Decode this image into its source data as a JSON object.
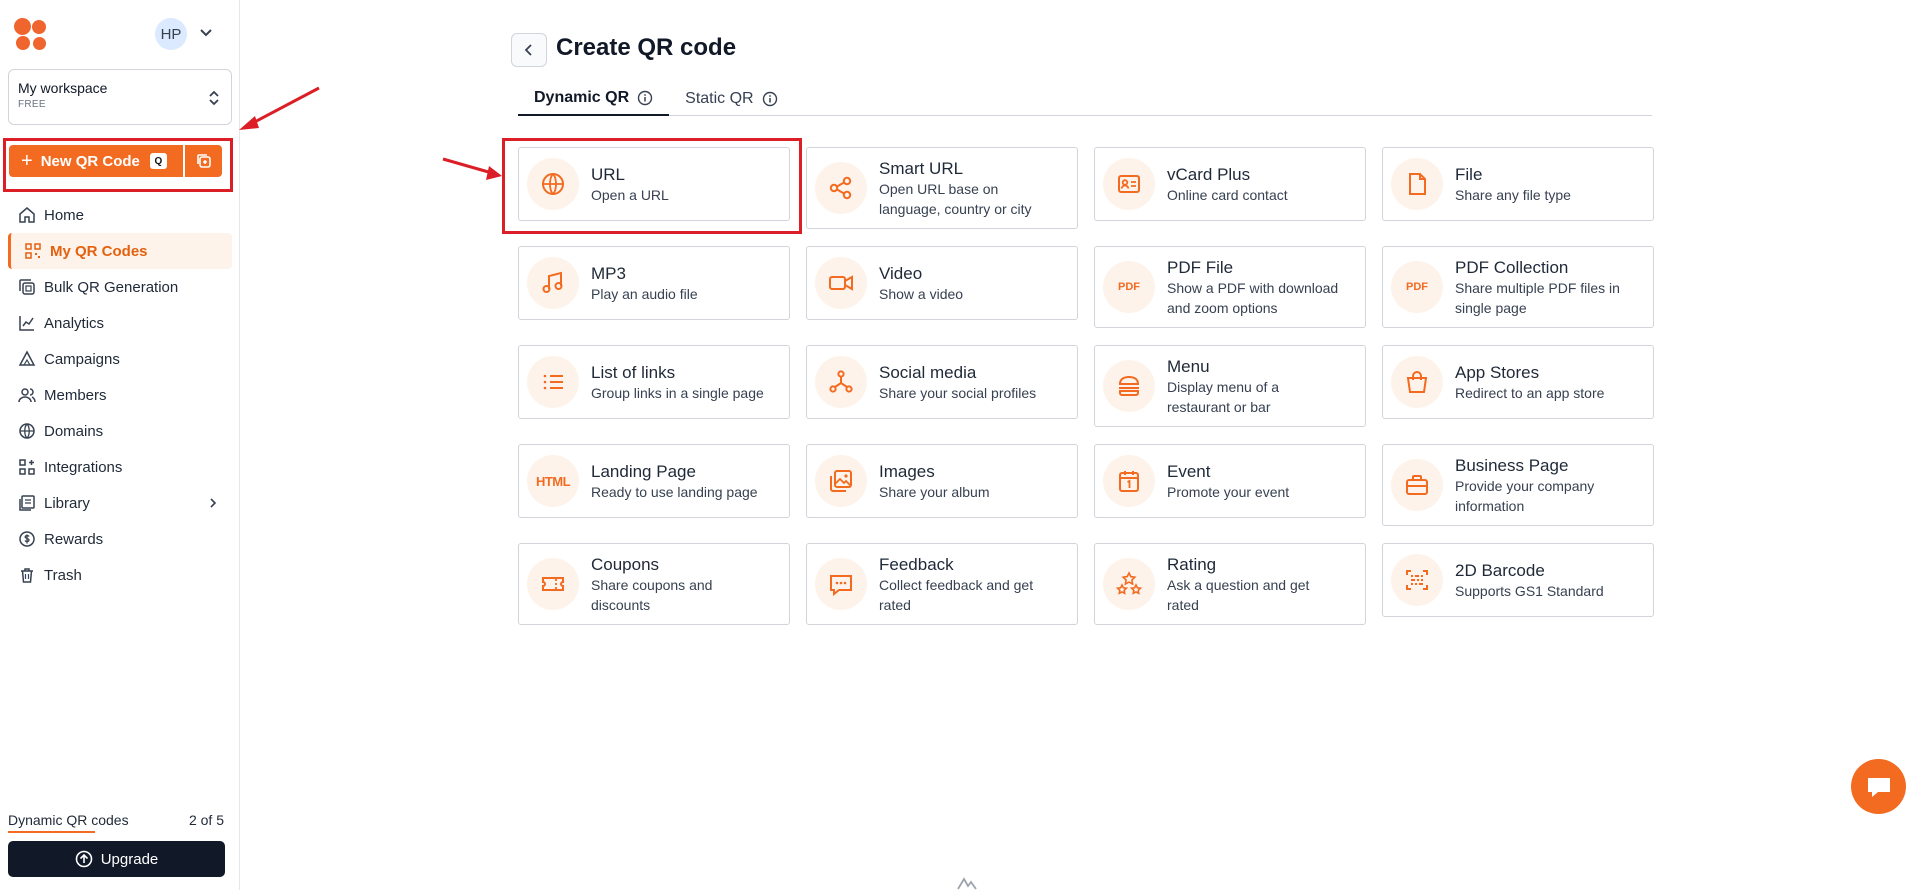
{
  "sidebar": {
    "avatar_initials": "HP",
    "workspace": {
      "name": "My workspace",
      "plan": "FREE"
    },
    "new_qr": {
      "label": "New QR Code",
      "shortcut": "Q"
    },
    "nav": [
      {
        "label": "Home",
        "icon": "home-icon"
      },
      {
        "label": "My QR Codes",
        "icon": "qr-grid-icon",
        "active": true
      },
      {
        "label": "Bulk QR Generation",
        "icon": "bulk-icon"
      },
      {
        "label": "Analytics",
        "icon": "analytics-icon"
      },
      {
        "label": "Campaigns",
        "icon": "campaigns-icon"
      },
      {
        "label": "Members",
        "icon": "members-icon"
      },
      {
        "label": "Domains",
        "icon": "globe-icon"
      },
      {
        "label": "Integrations",
        "icon": "integrations-icon"
      },
      {
        "label": "Library",
        "icon": "library-icon",
        "has_submenu": true
      },
      {
        "label": "Rewards",
        "icon": "rewards-icon"
      },
      {
        "label": "Trash",
        "icon": "trash-icon"
      }
    ],
    "usage": {
      "label": "Dynamic QR codes",
      "count": "2 of 5",
      "fraction": 0.4
    },
    "upgrade_label": "Upgrade"
  },
  "main": {
    "title": "Create QR code",
    "tabs": [
      {
        "label": "Dynamic QR",
        "active": true
      },
      {
        "label": "Static QR",
        "active": false
      }
    ],
    "types": [
      {
        "title": "URL",
        "desc": "Open a URL",
        "icon": "globe-icon"
      },
      {
        "title": "Smart URL",
        "desc": "Open URL base on language, country or city",
        "icon": "share-icon"
      },
      {
        "title": "vCard Plus",
        "desc": "Online card contact",
        "icon": "contact-card-icon"
      },
      {
        "title": "File",
        "desc": "Share any file type",
        "icon": "file-icon"
      },
      {
        "title": "MP3",
        "desc": "Play an audio file",
        "icon": "music-icon"
      },
      {
        "title": "Video",
        "desc": "Show a video",
        "icon": "video-icon"
      },
      {
        "title": "PDF File",
        "desc": "Show a PDF with download and zoom options",
        "icon": "pdf-icon"
      },
      {
        "title": "PDF Collection",
        "desc": "Share multiple PDF files in single page",
        "icon": "pdf-collection-icon"
      },
      {
        "title": "List of links",
        "desc": "Group links in a single page",
        "icon": "list-icon"
      },
      {
        "title": "Social media",
        "desc": "Share your social profiles",
        "icon": "social-icon"
      },
      {
        "title": "Menu",
        "desc": "Display menu of a restaurant or bar",
        "icon": "burger-icon"
      },
      {
        "title": "App Stores",
        "desc": "Redirect to an app store",
        "icon": "shopping-bag-icon"
      },
      {
        "title": "Landing Page",
        "desc": "Ready to use landing page",
        "icon": "html-icon"
      },
      {
        "title": "Images",
        "desc": "Share your album",
        "icon": "images-icon"
      },
      {
        "title": "Event",
        "desc": "Promote your event",
        "icon": "calendar-icon"
      },
      {
        "title": "Business Page",
        "desc": "Provide your company information",
        "icon": "briefcase-icon"
      },
      {
        "title": "Coupons",
        "desc": "Share coupons and discounts",
        "icon": "ticket-icon"
      },
      {
        "title": "Feedback",
        "desc": "Collect feedback and get rated",
        "icon": "chat-icon"
      },
      {
        "title": "Rating",
        "desc": "Ask a question and get rated",
        "icon": "stars-icon"
      },
      {
        "title": "2D Barcode",
        "desc": "Supports GS1 Standard",
        "icon": "barcode-icon"
      }
    ],
    "type_icon_labels": {
      "html": "HTML",
      "pdf": "PDF"
    }
  },
  "colors": {
    "accent": "#f26b21",
    "highlight": "#dc1f26",
    "dark": "#111827"
  }
}
